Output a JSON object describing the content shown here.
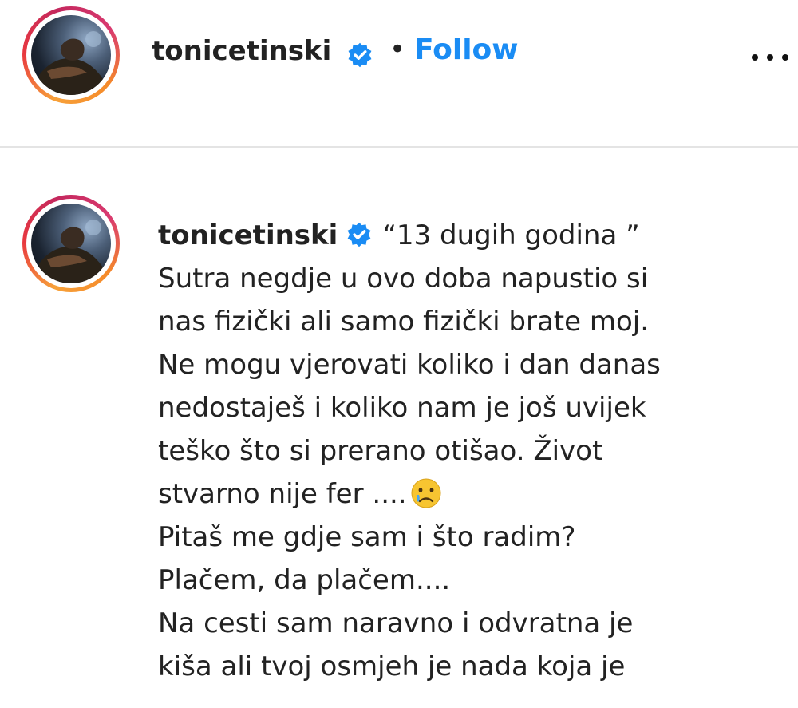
{
  "post_header": {
    "username": "tonicetinski",
    "separator": "•",
    "follow_label": "Follow",
    "more_icon": "more-options-icon",
    "verified_icon": "verified-badge-icon"
  },
  "caption": {
    "username": "tonicetinski",
    "lines": [
      "“13 dugih godina ”",
      "Sutra negdje u ovo doba napustio si",
      "nas fizički ali samo fizički brate moj.",
      "Ne mogu vjerovati koliko i dan danas",
      "nedostaješ i koliko nam je još uvijek",
      "teško što si prerano otišao. Život",
      "stvarno nije fer ....",
      "Pitaš me gdje sam i što radim?",
      "Plačem, da plačem....",
      "Na cesti sam naravno i odvratna je",
      "kiša ali tvoj osmjeh je nada koja je"
    ],
    "emoji_icon": "crying-face-emoji"
  },
  "colors": {
    "follow": "#1a8cf4",
    "verified": "#1a8cf4",
    "divider": "#e4e4e4",
    "text": "#222222"
  }
}
